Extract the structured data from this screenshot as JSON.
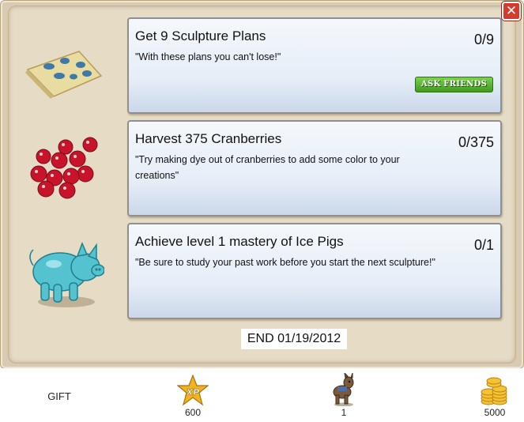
{
  "close_label": "✕",
  "goals": [
    {
      "title": "Get 9 Sculpture Plans",
      "description": "\"With these plans you can't lose!\"",
      "progress": "0/9",
      "action_label": "ASK FRIENDS",
      "icon": "sculpture-plans-icon"
    },
    {
      "title": "Harvest 375 Cranberries",
      "description": "\"Try making dye out of cranberries to add some color to your creations\"",
      "progress": "0/375",
      "icon": "cranberries-icon"
    },
    {
      "title": "Achieve level 1 mastery of Ice Pigs",
      "description": "\"Be sure to study your past work before you start the next sculpture!\"",
      "progress": "0/1",
      "icon": "ice-pig-icon"
    }
  ],
  "end_date": "END 01/19/2012",
  "rewards": {
    "gift_label": "GIFT",
    "xp_badge": "XP",
    "xp_value": "600",
    "item_value": "1",
    "coins_value": "5000",
    "icons": [
      "xp-star-icon",
      "donkey-icon",
      "coins-icon"
    ]
  },
  "colors": {
    "ask_button": "#4fae2a",
    "close_button": "#d63a2a"
  }
}
